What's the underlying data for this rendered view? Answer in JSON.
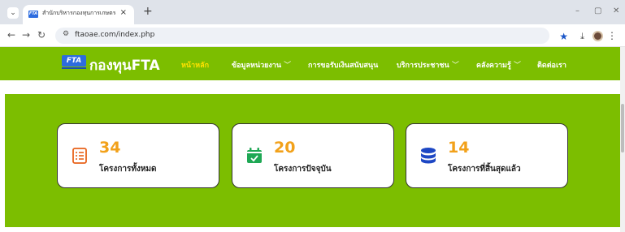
{
  "browser": {
    "tab_title": "สำนักบริหารกองทุนการเกษตร",
    "tab_close": "×",
    "new_tab": "+",
    "url": "ftaoae.com/index.php",
    "win_min": "–",
    "win_max": "▢",
    "win_close": "✕"
  },
  "site": {
    "logo_badge": "FTA",
    "logo_text": "กองทุนFTA",
    "nav": [
      {
        "label": "หน้าหลัก",
        "active": true
      },
      {
        "label": "ข้อมูลหน่วยงาน",
        "dropdown": true
      },
      {
        "label": "การขอรับเงินสนับสนุน"
      },
      {
        "label": "บริการประชาชน",
        "dropdown": true
      },
      {
        "label": "คลังความรู้",
        "dropdown": true
      },
      {
        "label": "ติดต่อเรา"
      }
    ],
    "chevron": "﹀"
  },
  "stats": [
    {
      "value": "34",
      "label": "โครงการทั้งหมด",
      "icon": "checklist-icon",
      "color": "#e8621a"
    },
    {
      "value": "20",
      "label": "โครงการปัจจุบัน",
      "icon": "calendar-check-icon",
      "color": "#1fa855"
    },
    {
      "value": "14",
      "label": "โครงการที่สิ้นสุดแล้ว",
      "icon": "database-icon",
      "color": "#1d47c4"
    }
  ],
  "colors": {
    "brand_green": "#7cbe00",
    "number_orange": "#f2a11a",
    "active_yellow": "#ffe100"
  }
}
